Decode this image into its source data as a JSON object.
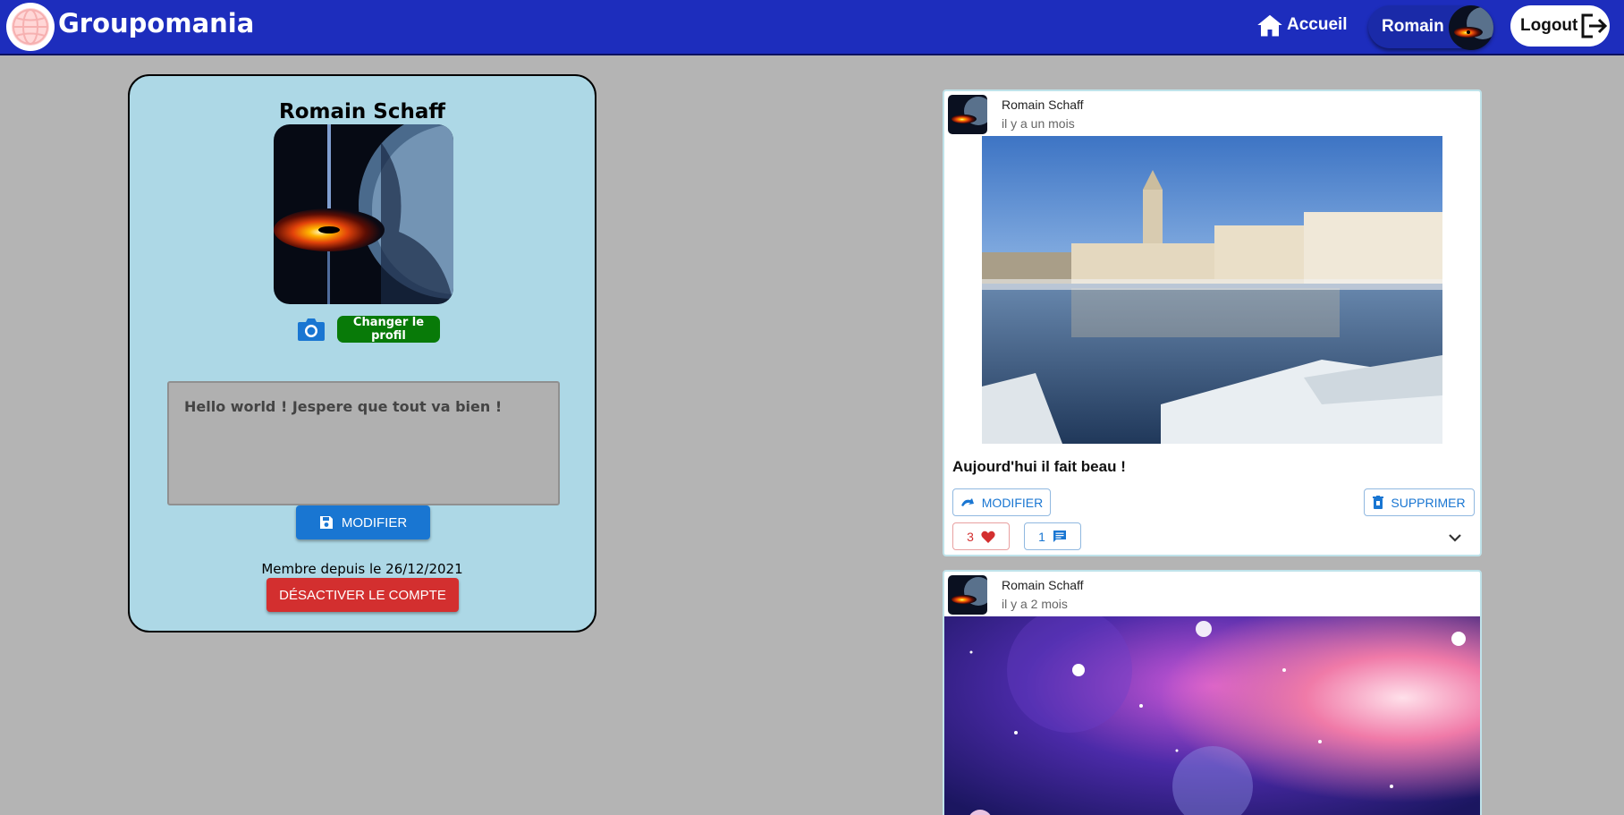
{
  "header": {
    "brand": "Groupomania",
    "home_label": "Accueil",
    "user_label": "Romain",
    "logout_label": "Logout"
  },
  "profile": {
    "name": "Romain Schaff",
    "change_label": "Changer le profil",
    "bio": "Hello world ! Jespere que tout va bien !",
    "save_label": "MODIFIER",
    "member_since": "Membre depuis le 26/12/2021",
    "deactivate_label": "DÉSACTIVER LE COMPTE"
  },
  "posts": [
    {
      "author": "Romain Schaff",
      "date": "il y a un mois",
      "caption": "Aujourd'hui il fait beau !",
      "edit_label": "MODIFIER",
      "delete_label": "SUPPRIMER",
      "likes": "3",
      "comments": "1"
    },
    {
      "author": "Romain Schaff",
      "date": "il y a 2 mois"
    }
  ],
  "colors": {
    "header": "#1d2dbd",
    "background": "#b4b4b4",
    "profile_card": "#add8e6",
    "primary": "#1976d2",
    "danger": "#d32f2f",
    "success": "#087a08"
  }
}
